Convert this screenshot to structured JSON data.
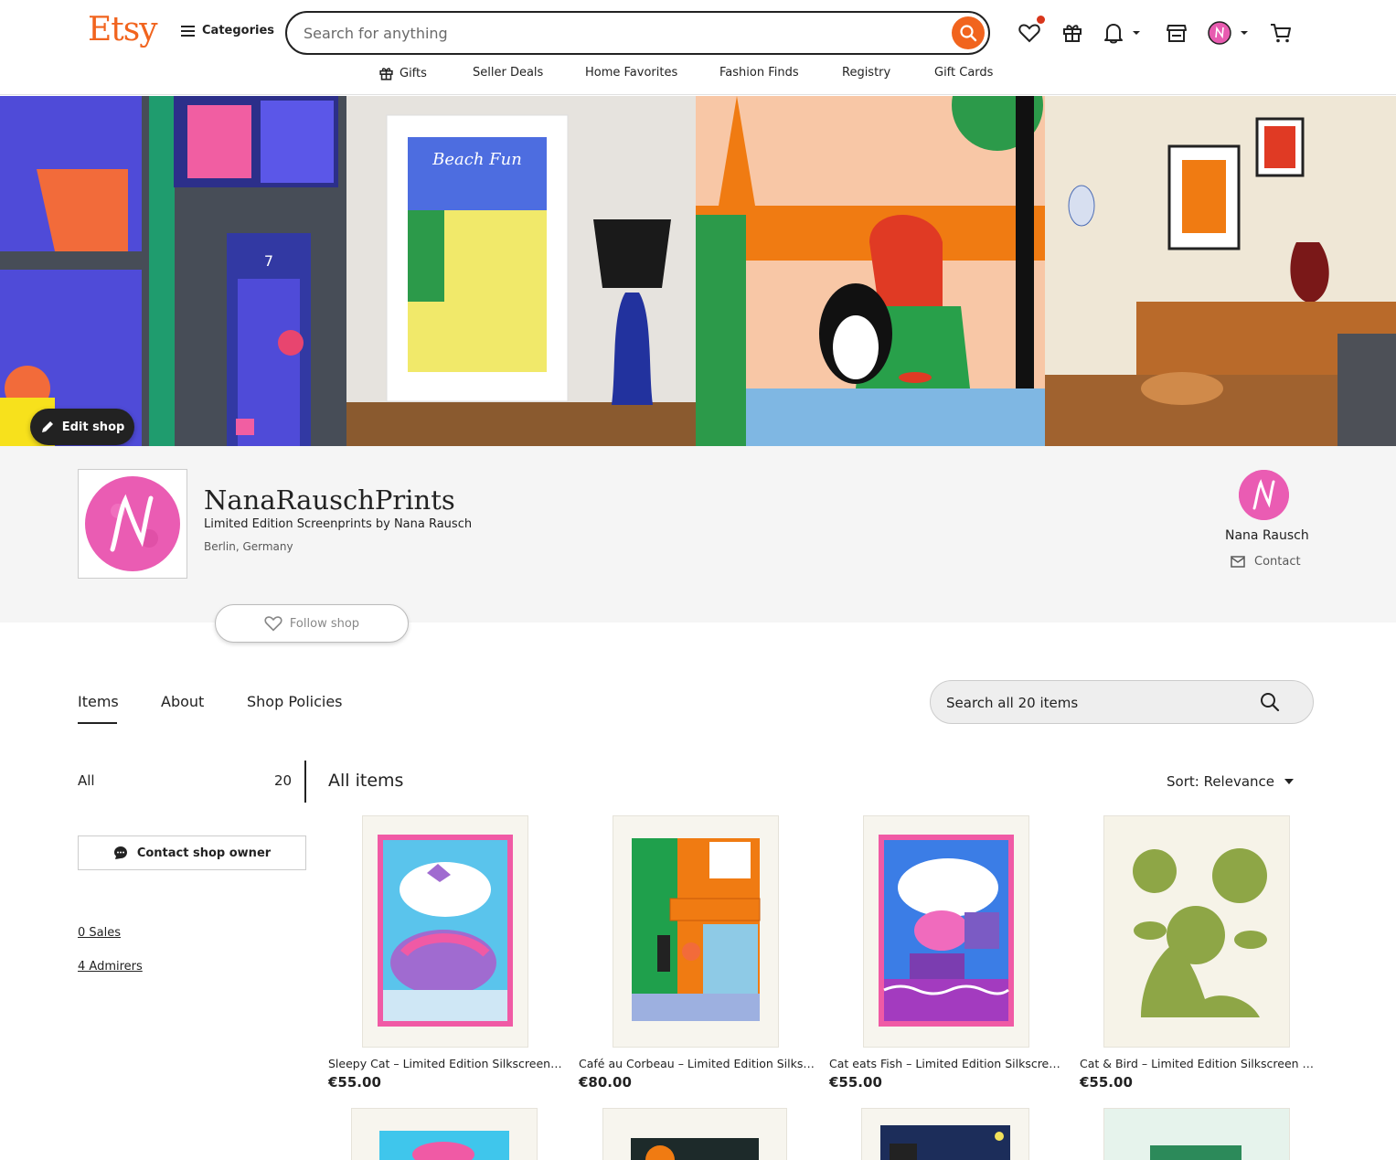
{
  "header": {
    "logo": "Etsy",
    "categories_label": "Categories",
    "search_placeholder": "Search for anything",
    "nav": [
      {
        "label": "Gifts"
      },
      {
        "label": "Seller Deals"
      },
      {
        "label": "Home Favorites"
      },
      {
        "label": "Fashion Finds"
      },
      {
        "label": "Registry"
      },
      {
        "label": "Gift Cards"
      }
    ],
    "icons": [
      "heart-icon",
      "gift-icon",
      "bell-icon",
      "shop-icon",
      "avatar",
      "cart-icon"
    ],
    "accent_color": "#f1641e"
  },
  "banner": {
    "edit_shop_label": "Edit shop"
  },
  "shop": {
    "name": "NanaRauschPrints",
    "tagline": "Limited Edition Screenprints by Nana Rausch",
    "location": "Berlin, Germany",
    "owner_name": "Nana Rausch",
    "contact_label": "Contact",
    "follow_label": "Follow shop",
    "avatar_color": "#e85bb0"
  },
  "tabs": {
    "items": "Items",
    "about": "About",
    "policies": "Shop Policies",
    "search_placeholder": "Search all 20 items"
  },
  "sidebar": {
    "all_label": "All",
    "all_count": "20",
    "contact_owner_label": "Contact shop owner",
    "sales_link": "0 Sales",
    "admirers_link": "4 Admirers"
  },
  "main": {
    "title": "All items",
    "sort_label": "Sort: Relevance",
    "listings": [
      {
        "title": "Sleepy Cat – Limited Edition Silkscreen Print",
        "price": "€55.00"
      },
      {
        "title": "Café au Corbeau – Limited Edition Silkscreen Print",
        "price": "€80.00"
      },
      {
        "title": "Cat eats Fish – Limited Edition Silkscreen Print",
        "price": "€55.00"
      },
      {
        "title": "Cat & Bird – Limited Edition Silkscreen Print",
        "price": "€55.00"
      }
    ]
  }
}
